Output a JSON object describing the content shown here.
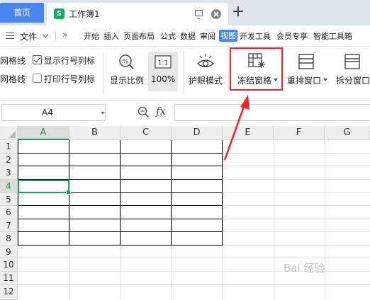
{
  "titlebar": {
    "home_tab": "首页",
    "doc_tab_icon": "S",
    "doc_tab_title": "工作簿1",
    "new_tab": "+"
  },
  "menubar": {
    "file": "文件",
    "more": "»",
    "items": [
      "开始",
      "插入",
      "页面布局",
      "公式",
      "数据",
      "审阅",
      "视图",
      "开发工具",
      "会员专享",
      "智能工具箱"
    ],
    "active_item": "视图"
  },
  "ribbon": {
    "gridlines_top": "网格线",
    "gridlines_bottom": "网格线",
    "show_row_col": "显示行号列标",
    "show_row_col_checked": true,
    "print_row_col": "打印行号列标",
    "print_row_col_checked": false,
    "zoom_label": "显示比例",
    "zoom_icon_text": "1:1",
    "zoom_value": "100%",
    "eye_protect": "护眼模式",
    "freeze_panes": "冻结窗格",
    "arrange_window": "重排窗口",
    "split_window": "拆分窗口"
  },
  "formula_bar": {
    "cell_ref": "A4",
    "fx": "fx",
    "formula": ""
  },
  "grid": {
    "columns": [
      "A",
      "B",
      "C",
      "D",
      "E",
      "F",
      "G"
    ],
    "rows": [
      "1",
      "2",
      "3",
      "4",
      "5",
      "6",
      "7",
      "8",
      "9",
      "10",
      "11",
      "12"
    ],
    "active_col": "A",
    "active_row": "4"
  },
  "watermark": "Bai 经验",
  "colors": {
    "accent_blue": "#4a86f0",
    "selection_green": "#1f9d55",
    "highlight_red": "#e8262a",
    "doc_icon_green": "#1aa668"
  }
}
